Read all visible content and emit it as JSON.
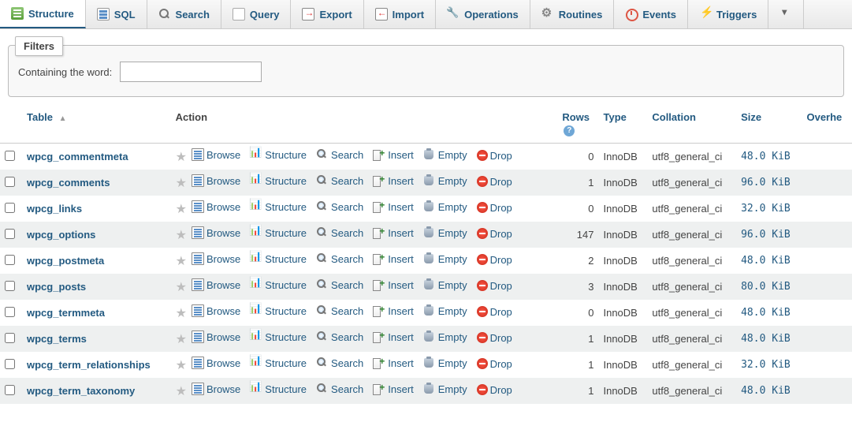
{
  "tabs": [
    {
      "label": "Structure",
      "icon": "structure",
      "active": true
    },
    {
      "label": "SQL",
      "icon": "sql"
    },
    {
      "label": "Search",
      "icon": "search"
    },
    {
      "label": "Query",
      "icon": "query"
    },
    {
      "label": "Export",
      "icon": "export"
    },
    {
      "label": "Import",
      "icon": "import"
    },
    {
      "label": "Operations",
      "icon": "ops"
    },
    {
      "label": "Routines",
      "icon": "routines"
    },
    {
      "label": "Events",
      "icon": "events"
    },
    {
      "label": "Triggers",
      "icon": "triggers"
    }
  ],
  "filters": {
    "legend": "Filters",
    "containing_label": "Containing the word:",
    "containing_value": ""
  },
  "columns": {
    "table": "Table",
    "action": "Action",
    "rows": "Rows",
    "type": "Type",
    "collation": "Collation",
    "size": "Size",
    "overhead": "Overhe"
  },
  "action_labels": {
    "browse": "Browse",
    "structure": "Structure",
    "search": "Search",
    "insert": "Insert",
    "empty": "Empty",
    "drop": "Drop"
  },
  "rows": [
    {
      "name": "wpcg_commentmeta",
      "rows": "0",
      "type": "InnoDB",
      "collation": "utf8_general_ci",
      "size": "48.0 KiB"
    },
    {
      "name": "wpcg_comments",
      "rows": "1",
      "type": "InnoDB",
      "collation": "utf8_general_ci",
      "size": "96.0 KiB"
    },
    {
      "name": "wpcg_links",
      "rows": "0",
      "type": "InnoDB",
      "collation": "utf8_general_ci",
      "size": "32.0 KiB"
    },
    {
      "name": "wpcg_options",
      "rows": "147",
      "type": "InnoDB",
      "collation": "utf8_general_ci",
      "size": "96.0 KiB"
    },
    {
      "name": "wpcg_postmeta",
      "rows": "2",
      "type": "InnoDB",
      "collation": "utf8_general_ci",
      "size": "48.0 KiB"
    },
    {
      "name": "wpcg_posts",
      "rows": "3",
      "type": "InnoDB",
      "collation": "utf8_general_ci",
      "size": "80.0 KiB"
    },
    {
      "name": "wpcg_termmeta",
      "rows": "0",
      "type": "InnoDB",
      "collation": "utf8_general_ci",
      "size": "48.0 KiB"
    },
    {
      "name": "wpcg_terms",
      "rows": "1",
      "type": "InnoDB",
      "collation": "utf8_general_ci",
      "size": "48.0 KiB"
    },
    {
      "name": "wpcg_term_relationships",
      "rows": "1",
      "type": "InnoDB",
      "collation": "utf8_general_ci",
      "size": "32.0 KiB"
    },
    {
      "name": "wpcg_term_taxonomy",
      "rows": "1",
      "type": "InnoDB",
      "collation": "utf8_general_ci",
      "size": "48.0 KiB"
    }
  ]
}
